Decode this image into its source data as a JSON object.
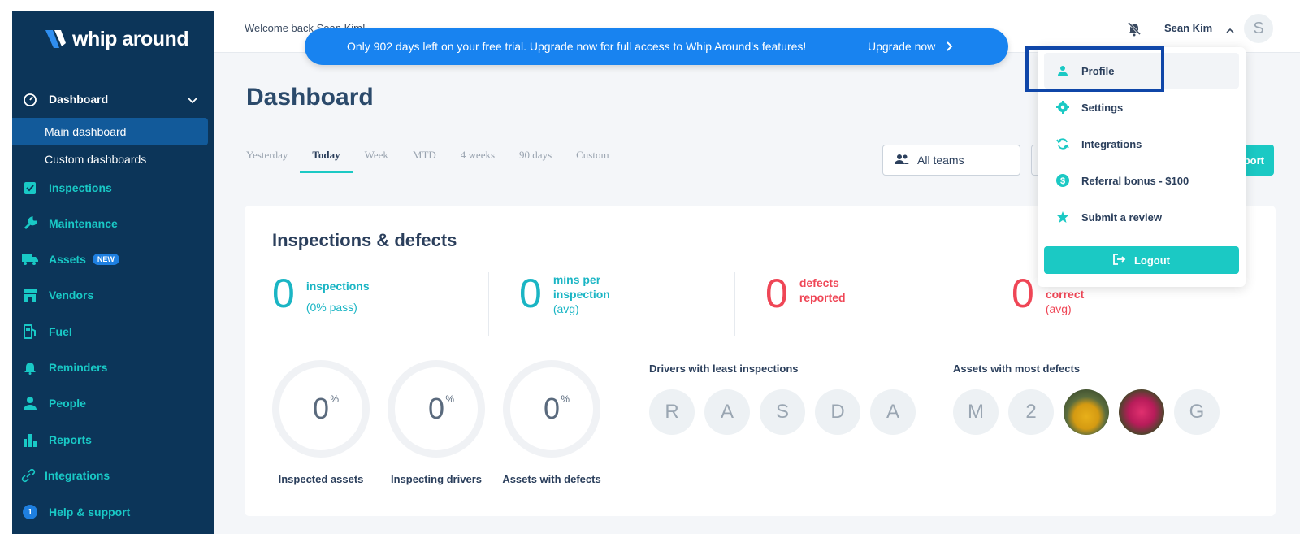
{
  "app": {
    "logo_text": "whip around"
  },
  "sidebar": {
    "dashboard": {
      "label": "Dashboard",
      "sub": [
        {
          "label": "Main dashboard"
        },
        {
          "label": "Custom dashboards"
        }
      ]
    },
    "items": [
      {
        "label": "Inspections",
        "icon": "clipboard-check-icon"
      },
      {
        "label": "Maintenance",
        "icon": "wrench-icon"
      },
      {
        "label": "Assets",
        "icon": "truck-icon",
        "badge": "NEW"
      },
      {
        "label": "Vendors",
        "icon": "store-icon"
      },
      {
        "label": "Fuel",
        "icon": "fuel-pump-icon"
      },
      {
        "label": "Reminders",
        "icon": "bell-icon"
      },
      {
        "label": "People",
        "icon": "person-icon"
      },
      {
        "label": "Reports",
        "icon": "bar-chart-icon"
      },
      {
        "label": "Integrations",
        "icon": "link-icon"
      },
      {
        "label": "Help & support",
        "icon": "help-badge-icon",
        "badge_num": "1"
      }
    ]
  },
  "topbar": {
    "welcome": "Welcome back Sean Kim!",
    "user_name": "Sean Kim",
    "avatar_initial": "S"
  },
  "trial_banner": {
    "text": "Only 902 days left on your free trial. Upgrade now for full access to Whip Around's features!",
    "link": "Upgrade now"
  },
  "main": {
    "title": "Dashboard",
    "tabs": [
      "Yesterday",
      "Today",
      "Week",
      "MTD",
      "4 weeks",
      "90 days",
      "Custom"
    ],
    "active_tab": "Today",
    "teams_label": "All teams",
    "export_label": "port"
  },
  "card": {
    "title": "Inspections & defects",
    "stats": [
      {
        "value": "0",
        "label": "inspections",
        "sub": "(0% pass)"
      },
      {
        "value": "0",
        "label": "mins per inspection",
        "sub": "(avg)"
      },
      {
        "value": "0",
        "label": "defects reported",
        "sub": ""
      },
      {
        "value": "0",
        "label": "correct",
        "sub": "(avg)"
      }
    ],
    "rings": [
      {
        "value": "0",
        "unit": "%",
        "label": "Inspected assets"
      },
      {
        "value": "0",
        "unit": "%",
        "label": "Inspecting drivers"
      },
      {
        "value": "0",
        "unit": "%",
        "label": "Assets with defects"
      }
    ],
    "drivers_title": "Drivers with least inspections",
    "drivers": [
      "R",
      "A",
      "S",
      "D",
      "A"
    ],
    "assets_title": "Assets with most defects",
    "assets": [
      "M",
      "2",
      "",
      "",
      "G"
    ]
  },
  "dropdown": {
    "items": [
      {
        "label": "Profile",
        "icon": "person-icon"
      },
      {
        "label": "Settings",
        "icon": "gear-icon"
      },
      {
        "label": "Integrations",
        "icon": "sync-icon"
      },
      {
        "label": "Referral bonus - $100",
        "icon": "dollar-icon"
      },
      {
        "label": "Submit a review",
        "icon": "star-icon"
      }
    ],
    "logout": "Logout"
  },
  "colors": {
    "sidebar": "#0c3559",
    "accent": "#1bc9c4",
    "banner": "#1883f0",
    "danger": "#ef4656"
  }
}
